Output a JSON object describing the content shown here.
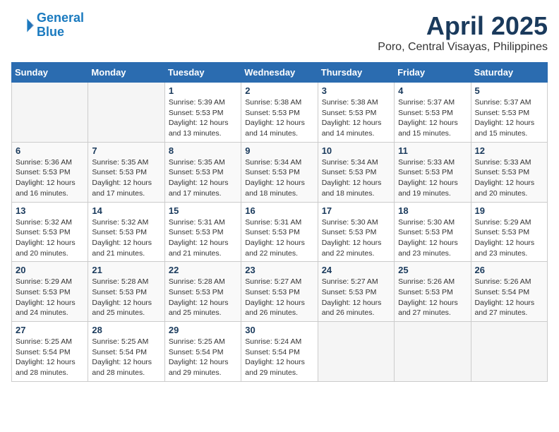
{
  "logo": {
    "line1": "General",
    "line2": "Blue"
  },
  "title": "April 2025",
  "subtitle": "Poro, Central Visayas, Philippines",
  "days_header": [
    "Sunday",
    "Monday",
    "Tuesday",
    "Wednesday",
    "Thursday",
    "Friday",
    "Saturday"
  ],
  "weeks": [
    [
      {
        "day": "",
        "sunrise": "",
        "sunset": "",
        "daylight": ""
      },
      {
        "day": "",
        "sunrise": "",
        "sunset": "",
        "daylight": ""
      },
      {
        "day": "1",
        "sunrise": "Sunrise: 5:39 AM",
        "sunset": "Sunset: 5:53 PM",
        "daylight": "Daylight: 12 hours and 13 minutes."
      },
      {
        "day": "2",
        "sunrise": "Sunrise: 5:38 AM",
        "sunset": "Sunset: 5:53 PM",
        "daylight": "Daylight: 12 hours and 14 minutes."
      },
      {
        "day": "3",
        "sunrise": "Sunrise: 5:38 AM",
        "sunset": "Sunset: 5:53 PM",
        "daylight": "Daylight: 12 hours and 14 minutes."
      },
      {
        "day": "4",
        "sunrise": "Sunrise: 5:37 AM",
        "sunset": "Sunset: 5:53 PM",
        "daylight": "Daylight: 12 hours and 15 minutes."
      },
      {
        "day": "5",
        "sunrise": "Sunrise: 5:37 AM",
        "sunset": "Sunset: 5:53 PM",
        "daylight": "Daylight: 12 hours and 15 minutes."
      }
    ],
    [
      {
        "day": "6",
        "sunrise": "Sunrise: 5:36 AM",
        "sunset": "Sunset: 5:53 PM",
        "daylight": "Daylight: 12 hours and 16 minutes."
      },
      {
        "day": "7",
        "sunrise": "Sunrise: 5:35 AM",
        "sunset": "Sunset: 5:53 PM",
        "daylight": "Daylight: 12 hours and 17 minutes."
      },
      {
        "day": "8",
        "sunrise": "Sunrise: 5:35 AM",
        "sunset": "Sunset: 5:53 PM",
        "daylight": "Daylight: 12 hours and 17 minutes."
      },
      {
        "day": "9",
        "sunrise": "Sunrise: 5:34 AM",
        "sunset": "Sunset: 5:53 PM",
        "daylight": "Daylight: 12 hours and 18 minutes."
      },
      {
        "day": "10",
        "sunrise": "Sunrise: 5:34 AM",
        "sunset": "Sunset: 5:53 PM",
        "daylight": "Daylight: 12 hours and 18 minutes."
      },
      {
        "day": "11",
        "sunrise": "Sunrise: 5:33 AM",
        "sunset": "Sunset: 5:53 PM",
        "daylight": "Daylight: 12 hours and 19 minutes."
      },
      {
        "day": "12",
        "sunrise": "Sunrise: 5:33 AM",
        "sunset": "Sunset: 5:53 PM",
        "daylight": "Daylight: 12 hours and 20 minutes."
      }
    ],
    [
      {
        "day": "13",
        "sunrise": "Sunrise: 5:32 AM",
        "sunset": "Sunset: 5:53 PM",
        "daylight": "Daylight: 12 hours and 20 minutes."
      },
      {
        "day": "14",
        "sunrise": "Sunrise: 5:32 AM",
        "sunset": "Sunset: 5:53 PM",
        "daylight": "Daylight: 12 hours and 21 minutes."
      },
      {
        "day": "15",
        "sunrise": "Sunrise: 5:31 AM",
        "sunset": "Sunset: 5:53 PM",
        "daylight": "Daylight: 12 hours and 21 minutes."
      },
      {
        "day": "16",
        "sunrise": "Sunrise: 5:31 AM",
        "sunset": "Sunset: 5:53 PM",
        "daylight": "Daylight: 12 hours and 22 minutes."
      },
      {
        "day": "17",
        "sunrise": "Sunrise: 5:30 AM",
        "sunset": "Sunset: 5:53 PM",
        "daylight": "Daylight: 12 hours and 22 minutes."
      },
      {
        "day": "18",
        "sunrise": "Sunrise: 5:30 AM",
        "sunset": "Sunset: 5:53 PM",
        "daylight": "Daylight: 12 hours and 23 minutes."
      },
      {
        "day": "19",
        "sunrise": "Sunrise: 5:29 AM",
        "sunset": "Sunset: 5:53 PM",
        "daylight": "Daylight: 12 hours and 23 minutes."
      }
    ],
    [
      {
        "day": "20",
        "sunrise": "Sunrise: 5:29 AM",
        "sunset": "Sunset: 5:53 PM",
        "daylight": "Daylight: 12 hours and 24 minutes."
      },
      {
        "day": "21",
        "sunrise": "Sunrise: 5:28 AM",
        "sunset": "Sunset: 5:53 PM",
        "daylight": "Daylight: 12 hours and 25 minutes."
      },
      {
        "day": "22",
        "sunrise": "Sunrise: 5:28 AM",
        "sunset": "Sunset: 5:53 PM",
        "daylight": "Daylight: 12 hours and 25 minutes."
      },
      {
        "day": "23",
        "sunrise": "Sunrise: 5:27 AM",
        "sunset": "Sunset: 5:53 PM",
        "daylight": "Daylight: 12 hours and 26 minutes."
      },
      {
        "day": "24",
        "sunrise": "Sunrise: 5:27 AM",
        "sunset": "Sunset: 5:53 PM",
        "daylight": "Daylight: 12 hours and 26 minutes."
      },
      {
        "day": "25",
        "sunrise": "Sunrise: 5:26 AM",
        "sunset": "Sunset: 5:53 PM",
        "daylight": "Daylight: 12 hours and 27 minutes."
      },
      {
        "day": "26",
        "sunrise": "Sunrise: 5:26 AM",
        "sunset": "Sunset: 5:54 PM",
        "daylight": "Daylight: 12 hours and 27 minutes."
      }
    ],
    [
      {
        "day": "27",
        "sunrise": "Sunrise: 5:25 AM",
        "sunset": "Sunset: 5:54 PM",
        "daylight": "Daylight: 12 hours and 28 minutes."
      },
      {
        "day": "28",
        "sunrise": "Sunrise: 5:25 AM",
        "sunset": "Sunset: 5:54 PM",
        "daylight": "Daylight: 12 hours and 28 minutes."
      },
      {
        "day": "29",
        "sunrise": "Sunrise: 5:25 AM",
        "sunset": "Sunset: 5:54 PM",
        "daylight": "Daylight: 12 hours and 29 minutes."
      },
      {
        "day": "30",
        "sunrise": "Sunrise: 5:24 AM",
        "sunset": "Sunset: 5:54 PM",
        "daylight": "Daylight: 12 hours and 29 minutes."
      },
      {
        "day": "",
        "sunrise": "",
        "sunset": "",
        "daylight": ""
      },
      {
        "day": "",
        "sunrise": "",
        "sunset": "",
        "daylight": ""
      },
      {
        "day": "",
        "sunrise": "",
        "sunset": "",
        "daylight": ""
      }
    ]
  ]
}
